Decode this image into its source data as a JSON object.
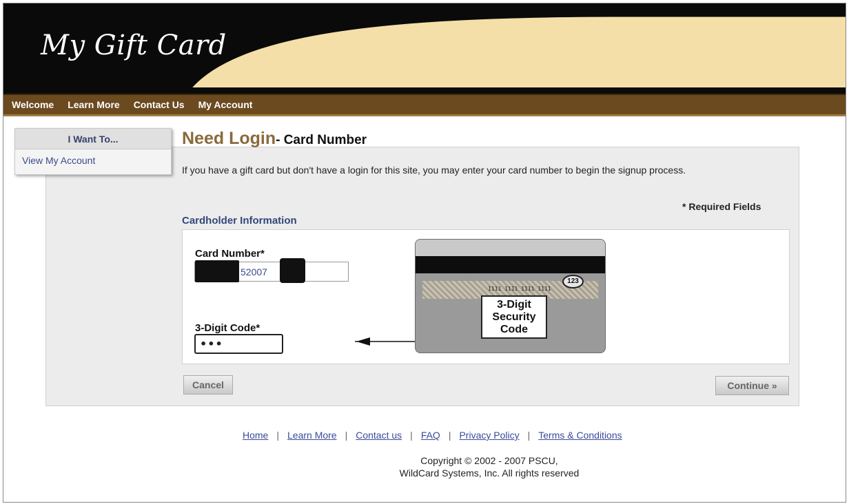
{
  "header": {
    "logo_text": "My Gift Card",
    "colors": {
      "background": "#0a0a0a",
      "swoosh": "#f5dfa8"
    }
  },
  "nav": {
    "items": [
      {
        "label": "Welcome"
      },
      {
        "label": "Learn More"
      },
      {
        "label": "Contact Us"
      },
      {
        "label": "My Account"
      }
    ],
    "color": "#6b4a1f"
  },
  "sidebar": {
    "title": "I Want To...",
    "items": [
      {
        "label": "View My Account"
      }
    ]
  },
  "main": {
    "title": "Need Login",
    "subtitle": "- Card Number",
    "intro": "If you have a gift card but don't have a login for this site, you may enter your card number to begin the signup process.",
    "required_note": "* Required Fields",
    "section_title": "Cardholder Information",
    "card_number": {
      "label": "Card Number*",
      "value": "52007"
    },
    "security_code": {
      "label": "3-Digit Code*",
      "value": "•••"
    },
    "card_image": {
      "sample_number": "1111 1111 1111 1111",
      "cvv": "123",
      "callout_lines": [
        "3-Digit",
        "Security",
        "Code"
      ]
    },
    "buttons": {
      "cancel": "Cancel",
      "continue": "Continue »"
    }
  },
  "footer": {
    "links": [
      {
        "label": "Home"
      },
      {
        "label": "Learn More"
      },
      {
        "label": "Contact us"
      },
      {
        "label": "FAQ"
      },
      {
        "label": "Privacy Policy"
      },
      {
        "label": "Terms & Conditions"
      }
    ],
    "copyright_line1": "Copyright © 2002 - 2007 PSCU,",
    "copyright_line2": "WildCard Systems, Inc. All rights reserved"
  }
}
